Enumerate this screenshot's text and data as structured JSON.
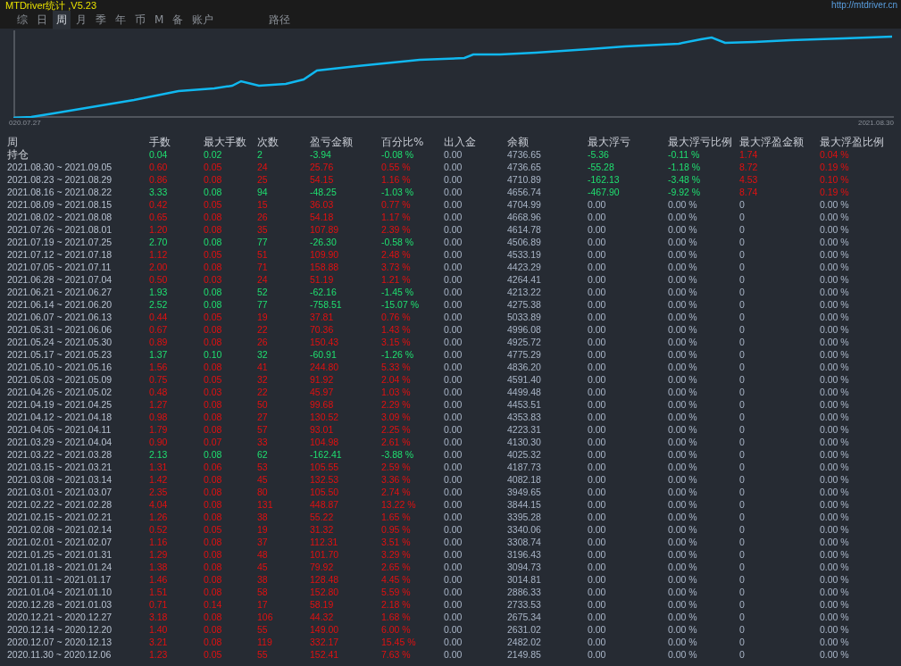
{
  "window": {
    "title": "MTDriver统计 ,V5.23",
    "link": "http://mtdriver.cn"
  },
  "tabs": [
    {
      "label": "综",
      "selected": false
    },
    {
      "label": "日",
      "selected": false
    },
    {
      "label": "周",
      "selected": true
    },
    {
      "label": "月",
      "selected": false
    },
    {
      "label": "季",
      "selected": false
    },
    {
      "label": "年",
      "selected": false
    },
    {
      "label": "币",
      "selected": false
    },
    {
      "label": "M",
      "selected": false
    },
    {
      "label": "备",
      "selected": false
    },
    {
      "label": "账户",
      "selected": false
    }
  ],
  "path_tab": {
    "label": "路径",
    "selected": false
  },
  "chart": {
    "start_label": "020.07.27",
    "end_label": "2021.08.30"
  },
  "table": {
    "columns": [
      "周",
      "手数",
      "最大手数",
      "次数",
      "盈亏金额",
      "百分比%",
      "出入金",
      "余额",
      "最大浮亏",
      "最大浮亏比例",
      "最大浮盈金额",
      "最大浮盈比例"
    ],
    "rows": [
      {
        "kind": "loss",
        "floating": true,
        "cells": [
          "持仓",
          "0.04",
          "0.02",
          "2",
          "-3.94",
          "-0.08 %",
          "0.00",
          "4736.65",
          "-5.36",
          "-0.11 %",
          "1.74",
          "0.04 %"
        ]
      },
      {
        "kind": "gain",
        "floating": true,
        "cells": [
          "2021.08.30 ~ 2021.09.05",
          "0.60",
          "0.05",
          "24",
          "25.76",
          "0.55 %",
          "0.00",
          "4736.65",
          "-55.28",
          "-1.18 %",
          "8.72",
          "0.19 %"
        ]
      },
      {
        "kind": "gain",
        "floating": true,
        "cells": [
          "2021.08.23 ~ 2021.08.29",
          "0.86",
          "0.08",
          "25",
          "54.15",
          "1.16 %",
          "0.00",
          "4710.89",
          "-162.13",
          "-3.48 %",
          "4.53",
          "0.10 %"
        ]
      },
      {
        "kind": "loss",
        "floating": true,
        "cells": [
          "2021.08.16 ~ 2021.08.22",
          "3.33",
          "0.08",
          "94",
          "-48.25",
          "-1.03 %",
          "0.00",
          "4656.74",
          "-467.90",
          "-9.92 %",
          "8.74",
          "0.19 %"
        ]
      },
      {
        "kind": "gain",
        "floating": false,
        "cells": [
          "2021.08.09 ~ 2021.08.15",
          "0.42",
          "0.05",
          "15",
          "36.03",
          "0.77 %",
          "0.00",
          "4704.99",
          "0.00",
          "0.00 %",
          "0",
          "0.00 %"
        ]
      },
      {
        "kind": "gain",
        "floating": false,
        "cells": [
          "2021.08.02 ~ 2021.08.08",
          "0.65",
          "0.08",
          "26",
          "54.18",
          "1.17 %",
          "0.00",
          "4668.96",
          "0.00",
          "0.00 %",
          "0",
          "0.00 %"
        ]
      },
      {
        "kind": "gain",
        "floating": false,
        "cells": [
          "2021.07.26 ~ 2021.08.01",
          "1.20",
          "0.08",
          "35",
          "107.89",
          "2.39 %",
          "0.00",
          "4614.78",
          "0.00",
          "0.00 %",
          "0",
          "0.00 %"
        ]
      },
      {
        "kind": "loss",
        "floating": false,
        "cells": [
          "2021.07.19 ~ 2021.07.25",
          "2.70",
          "0.08",
          "77",
          "-26.30",
          "-0.58 %",
          "0.00",
          "4506.89",
          "0.00",
          "0.00 %",
          "0",
          "0.00 %"
        ]
      },
      {
        "kind": "gain",
        "floating": false,
        "cells": [
          "2021.07.12 ~ 2021.07.18",
          "1.12",
          "0.05",
          "51",
          "109.90",
          "2.48 %",
          "0.00",
          "4533.19",
          "0.00",
          "0.00 %",
          "0",
          "0.00 %"
        ]
      },
      {
        "kind": "gain",
        "floating": false,
        "cells": [
          "2021.07.05 ~ 2021.07.11",
          "2.00",
          "0.08",
          "71",
          "158.88",
          "3.73 %",
          "0.00",
          "4423.29",
          "0.00",
          "0.00 %",
          "0",
          "0.00 %"
        ]
      },
      {
        "kind": "gain",
        "floating": false,
        "cells": [
          "2021.06.28 ~ 2021.07.04",
          "0.50",
          "0.03",
          "24",
          "51.19",
          "1.21 %",
          "0.00",
          "4264.41",
          "0.00",
          "0.00 %",
          "0",
          "0.00 %"
        ]
      },
      {
        "kind": "loss",
        "floating": false,
        "cells": [
          "2021.06.21 ~ 2021.06.27",
          "1.93",
          "0.08",
          "52",
          "-62.16",
          "-1.45 %",
          "0.00",
          "4213.22",
          "0.00",
          "0.00 %",
          "0",
          "0.00 %"
        ]
      },
      {
        "kind": "loss",
        "floating": false,
        "cells": [
          "2021.06.14 ~ 2021.06.20",
          "2.52",
          "0.08",
          "77",
          "-758.51",
          "-15.07 %",
          "0.00",
          "4275.38",
          "0.00",
          "0.00 %",
          "0",
          "0.00 %"
        ]
      },
      {
        "kind": "gain",
        "floating": false,
        "cells": [
          "2021.06.07 ~ 2021.06.13",
          "0.44",
          "0.05",
          "19",
          "37.81",
          "0.76 %",
          "0.00",
          "5033.89",
          "0.00",
          "0.00 %",
          "0",
          "0.00 %"
        ]
      },
      {
        "kind": "gain",
        "floating": false,
        "cells": [
          "2021.05.31 ~ 2021.06.06",
          "0.67",
          "0.08",
          "22",
          "70.36",
          "1.43 %",
          "0.00",
          "4996.08",
          "0.00",
          "0.00 %",
          "0",
          "0.00 %"
        ]
      },
      {
        "kind": "gain",
        "floating": false,
        "cells": [
          "2021.05.24 ~ 2021.05.30",
          "0.89",
          "0.08",
          "26",
          "150.43",
          "3.15 %",
          "0.00",
          "4925.72",
          "0.00",
          "0.00 %",
          "0",
          "0.00 %"
        ]
      },
      {
        "kind": "loss",
        "floating": false,
        "cells": [
          "2021.05.17 ~ 2021.05.23",
          "1.37",
          "0.10",
          "32",
          "-60.91",
          "-1.26 %",
          "0.00",
          "4775.29",
          "0.00",
          "0.00 %",
          "0",
          "0.00 %"
        ]
      },
      {
        "kind": "gain",
        "floating": false,
        "cells": [
          "2021.05.10 ~ 2021.05.16",
          "1.56",
          "0.08",
          "41",
          "244.80",
          "5.33 %",
          "0.00",
          "4836.20",
          "0.00",
          "0.00 %",
          "0",
          "0.00 %"
        ]
      },
      {
        "kind": "gain",
        "floating": false,
        "cells": [
          "2021.05.03 ~ 2021.05.09",
          "0.75",
          "0.05",
          "32",
          "91.92",
          "2.04 %",
          "0.00",
          "4591.40",
          "0.00",
          "0.00 %",
          "0",
          "0.00 %"
        ]
      },
      {
        "kind": "gain",
        "floating": false,
        "cells": [
          "2021.04.26 ~ 2021.05.02",
          "0.48",
          "0.03",
          "22",
          "45.97",
          "1.03 %",
          "0.00",
          "4499.48",
          "0.00",
          "0.00 %",
          "0",
          "0.00 %"
        ]
      },
      {
        "kind": "gain",
        "floating": false,
        "cells": [
          "2021.04.19 ~ 2021.04.25",
          "1.27",
          "0.08",
          "50",
          "99.68",
          "2.29 %",
          "0.00",
          "4453.51",
          "0.00",
          "0.00 %",
          "0",
          "0.00 %"
        ]
      },
      {
        "kind": "gain",
        "floating": false,
        "cells": [
          "2021.04.12 ~ 2021.04.18",
          "0.98",
          "0.08",
          "27",
          "130.52",
          "3.09 %",
          "0.00",
          "4353.83",
          "0.00",
          "0.00 %",
          "0",
          "0.00 %"
        ]
      },
      {
        "kind": "gain",
        "floating": false,
        "cells": [
          "2021.04.05 ~ 2021.04.11",
          "1.79",
          "0.08",
          "57",
          "93.01",
          "2.25 %",
          "0.00",
          "4223.31",
          "0.00",
          "0.00 %",
          "0",
          "0.00 %"
        ]
      },
      {
        "kind": "gain",
        "floating": false,
        "cells": [
          "2021.03.29 ~ 2021.04.04",
          "0.90",
          "0.07",
          "33",
          "104.98",
          "2.61 %",
          "0.00",
          "4130.30",
          "0.00",
          "0.00 %",
          "0",
          "0.00 %"
        ]
      },
      {
        "kind": "loss",
        "floating": false,
        "cells": [
          "2021.03.22 ~ 2021.03.28",
          "2.13",
          "0.08",
          "62",
          "-162.41",
          "-3.88 %",
          "0.00",
          "4025.32",
          "0.00",
          "0.00 %",
          "0",
          "0.00 %"
        ]
      },
      {
        "kind": "gain",
        "floating": false,
        "cells": [
          "2021.03.15 ~ 2021.03.21",
          "1.31",
          "0.06",
          "53",
          "105.55",
          "2.59 %",
          "0.00",
          "4187.73",
          "0.00",
          "0.00 %",
          "0",
          "0.00 %"
        ]
      },
      {
        "kind": "gain",
        "floating": false,
        "cells": [
          "2021.03.08 ~ 2021.03.14",
          "1.42",
          "0.08",
          "45",
          "132.53",
          "3.36 %",
          "0.00",
          "4082.18",
          "0.00",
          "0.00 %",
          "0",
          "0.00 %"
        ]
      },
      {
        "kind": "gain",
        "floating": false,
        "cells": [
          "2021.03.01 ~ 2021.03.07",
          "2.35",
          "0.08",
          "80",
          "105.50",
          "2.74 %",
          "0.00",
          "3949.65",
          "0.00",
          "0.00 %",
          "0",
          "0.00 %"
        ]
      },
      {
        "kind": "gain",
        "floating": false,
        "cells": [
          "2021.02.22 ~ 2021.02.28",
          "4.04",
          "0.08",
          "131",
          "448.87",
          "13.22 %",
          "0.00",
          "3844.15",
          "0.00",
          "0.00 %",
          "0",
          "0.00 %"
        ]
      },
      {
        "kind": "gain",
        "floating": false,
        "cells": [
          "2021.02.15 ~ 2021.02.21",
          "1.26",
          "0.08",
          "38",
          "55.22",
          "1.65 %",
          "0.00",
          "3395.28",
          "0.00",
          "0.00 %",
          "0",
          "0.00 %"
        ]
      },
      {
        "kind": "gain",
        "floating": false,
        "cells": [
          "2021.02.08 ~ 2021.02.14",
          "0.52",
          "0.05",
          "19",
          "31.32",
          "0.95 %",
          "0.00",
          "3340.06",
          "0.00",
          "0.00 %",
          "0",
          "0.00 %"
        ]
      },
      {
        "kind": "gain",
        "floating": false,
        "cells": [
          "2021.02.01 ~ 2021.02.07",
          "1.16",
          "0.08",
          "37",
          "112.31",
          "3.51 %",
          "0.00",
          "3308.74",
          "0.00",
          "0.00 %",
          "0",
          "0.00 %"
        ]
      },
      {
        "kind": "gain",
        "floating": false,
        "cells": [
          "2021.01.25 ~ 2021.01.31",
          "1.29",
          "0.08",
          "48",
          "101.70",
          "3.29 %",
          "0.00",
          "3196.43",
          "0.00",
          "0.00 %",
          "0",
          "0.00 %"
        ]
      },
      {
        "kind": "gain",
        "floating": false,
        "cells": [
          "2021.01.18 ~ 2021.01.24",
          "1.38",
          "0.08",
          "45",
          "79.92",
          "2.65 %",
          "0.00",
          "3094.73",
          "0.00",
          "0.00 %",
          "0",
          "0.00 %"
        ]
      },
      {
        "kind": "gain",
        "floating": false,
        "cells": [
          "2021.01.11 ~ 2021.01.17",
          "1.46",
          "0.08",
          "38",
          "128.48",
          "4.45 %",
          "0.00",
          "3014.81",
          "0.00",
          "0.00 %",
          "0",
          "0.00 %"
        ]
      },
      {
        "kind": "gain",
        "floating": false,
        "cells": [
          "2021.01.04 ~ 2021.01.10",
          "1.51",
          "0.08",
          "58",
          "152.80",
          "5.59 %",
          "0.00",
          "2886.33",
          "0.00",
          "0.00 %",
          "0",
          "0.00 %"
        ]
      },
      {
        "kind": "gain",
        "floating": false,
        "cells": [
          "2020.12.28 ~ 2021.01.03",
          "0.71",
          "0.14",
          "17",
          "58.19",
          "2.18 %",
          "0.00",
          "2733.53",
          "0.00",
          "0.00 %",
          "0",
          "0.00 %"
        ]
      },
      {
        "kind": "gain",
        "floating": false,
        "cells": [
          "2020.12.21 ~ 2020.12.27",
          "3.18",
          "0.08",
          "106",
          "44.32",
          "1.68 %",
          "0.00",
          "2675.34",
          "0.00",
          "0.00 %",
          "0",
          "0.00 %"
        ]
      },
      {
        "kind": "gain",
        "floating": false,
        "cells": [
          "2020.12.14 ~ 2020.12.20",
          "1.40",
          "0.08",
          "55",
          "149.00",
          "6.00 %",
          "0.00",
          "2631.02",
          "0.00",
          "0.00 %",
          "0",
          "0.00 %"
        ]
      },
      {
        "kind": "gain",
        "floating": false,
        "cells": [
          "2020.12.07 ~ 2020.12.13",
          "3.21",
          "0.08",
          "119",
          "332.17",
          "15.45 %",
          "0.00",
          "2482.02",
          "0.00",
          "0.00 %",
          "0",
          "0.00 %"
        ]
      },
      {
        "kind": "gain",
        "floating": false,
        "cells": [
          "2020.11.30 ~ 2020.12.06",
          "1.23",
          "0.05",
          "55",
          "152.41",
          "7.63 %",
          "0.00",
          "2149.85",
          "0.00",
          "0.00 %",
          "0",
          "0.00 %"
        ]
      }
    ]
  }
}
